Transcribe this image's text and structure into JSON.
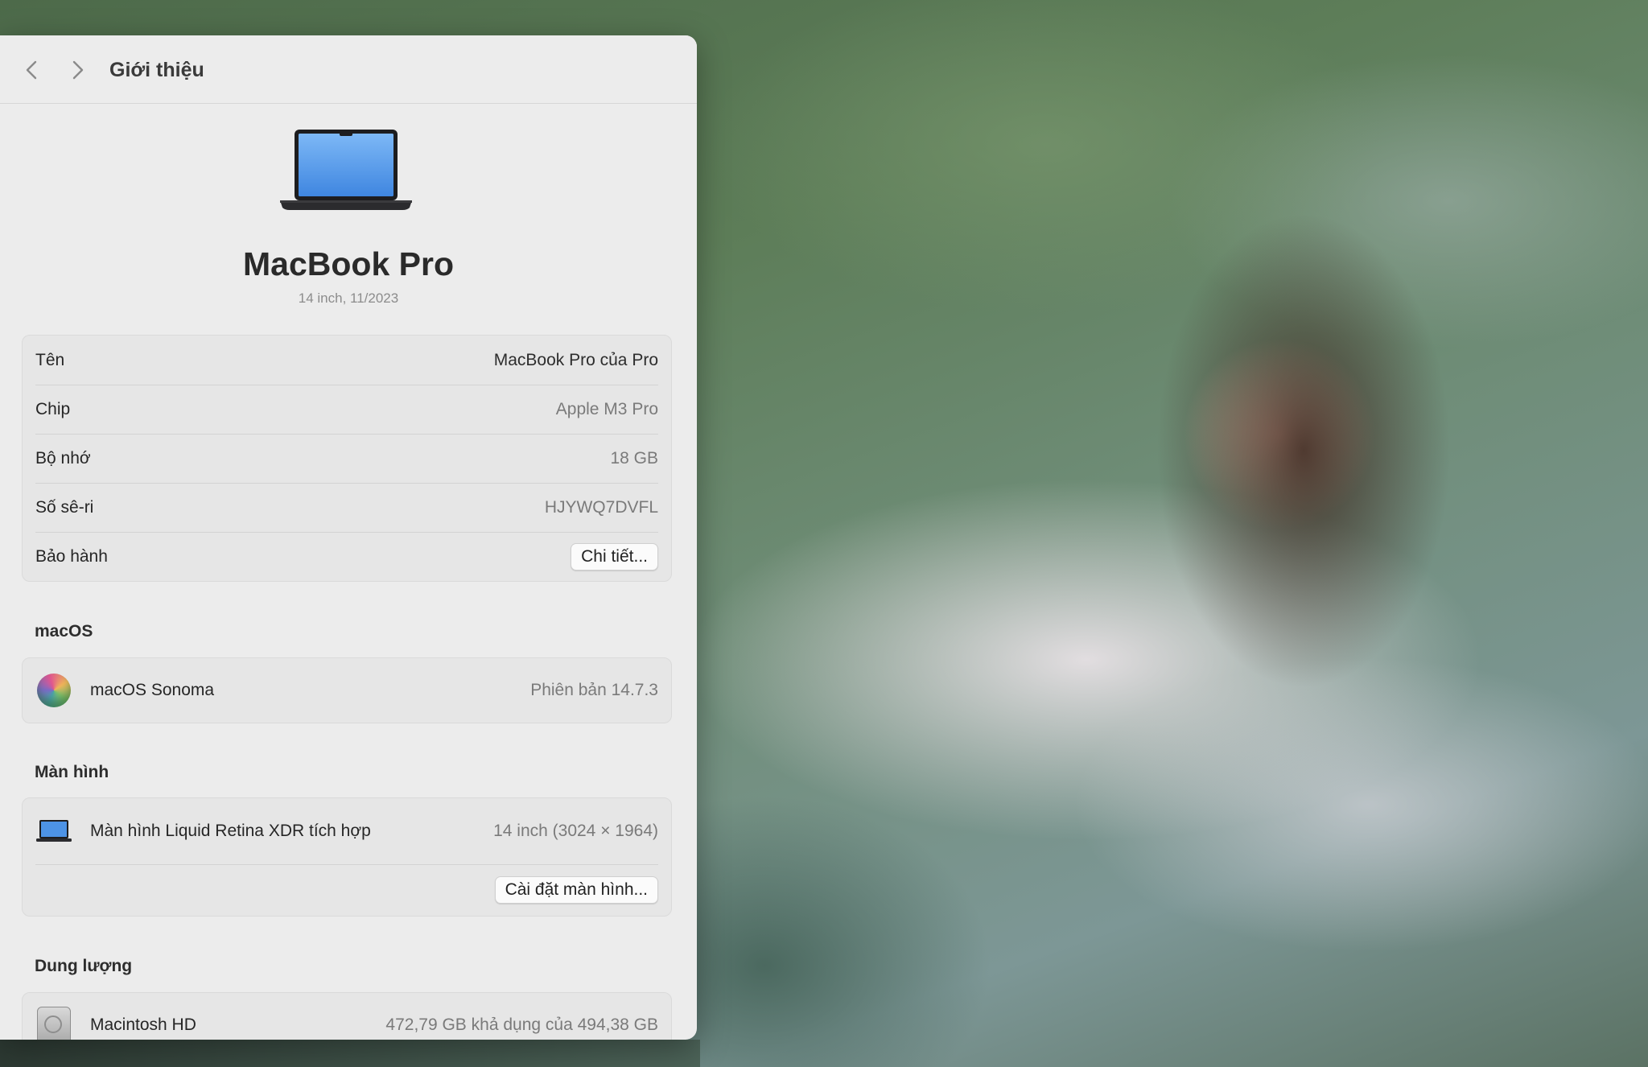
{
  "toolbar": {
    "title": "Giới thiệu",
    "back_icon": "chevron-left-icon",
    "forward_icon": "chevron-right-icon"
  },
  "device": {
    "name": "MacBook Pro",
    "subtitle": "14 inch, 11/2023",
    "icon": "macbook-icon"
  },
  "info": {
    "rows": [
      {
        "label": "Tên",
        "value": "MacBook Pro của Pro"
      },
      {
        "label": "Chip",
        "value": "Apple M3 Pro"
      },
      {
        "label": "Bộ nhớ",
        "value": "18 GB"
      },
      {
        "label": "Số sê-ri",
        "value": "HJYWQ7DVFL"
      },
      {
        "label": "Bảo hành",
        "button": "Chi tiết..."
      }
    ]
  },
  "macos": {
    "section_title": "macOS",
    "name": "macOS Sonoma",
    "version": "Phiên bản 14.7.3",
    "icon": "macos-sonoma-icon"
  },
  "display": {
    "section_title": "Màn hình",
    "name": "Màn hình Liquid Retina XDR tích hợp",
    "spec": "14 inch (3024 × 1964)",
    "button": "Cài đặt màn hình...",
    "icon": "laptop-display-icon"
  },
  "storage": {
    "section_title": "Dung lượng",
    "name": "Macintosh HD",
    "capacity": "472,79 GB khả dụng của 494,38 GB",
    "icon": "hard-drive-icon"
  },
  "colors": {
    "window_bg": "#ececec",
    "card_bg": "#e6e6e6",
    "secondary_text": "#7a7a7a"
  }
}
